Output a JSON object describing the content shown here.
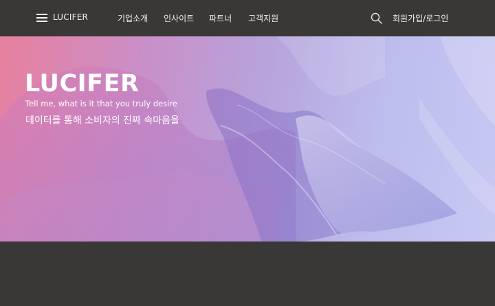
{
  "header": {
    "brand": "LUCIFER",
    "menu_icon": "hamburger-menu-icon",
    "nav_items": [
      {
        "label": "기업소개"
      },
      {
        "label": "인사이트"
      },
      {
        "label": "파트너"
      },
      {
        "label": "고객지원"
      }
    ],
    "search_icon": "search-icon",
    "auth_label": "회원가입/로그인"
  },
  "hero": {
    "title": "LUCIFER",
    "tagline": "Tell me, what is it that you truly desire",
    "subtitle": "데이터를 통해 소비자의 진짜 속마음을"
  },
  "colors": {
    "background": "#393836",
    "hero_gradient_start": "#e8809e",
    "hero_gradient_end": "#c8c8f3"
  }
}
